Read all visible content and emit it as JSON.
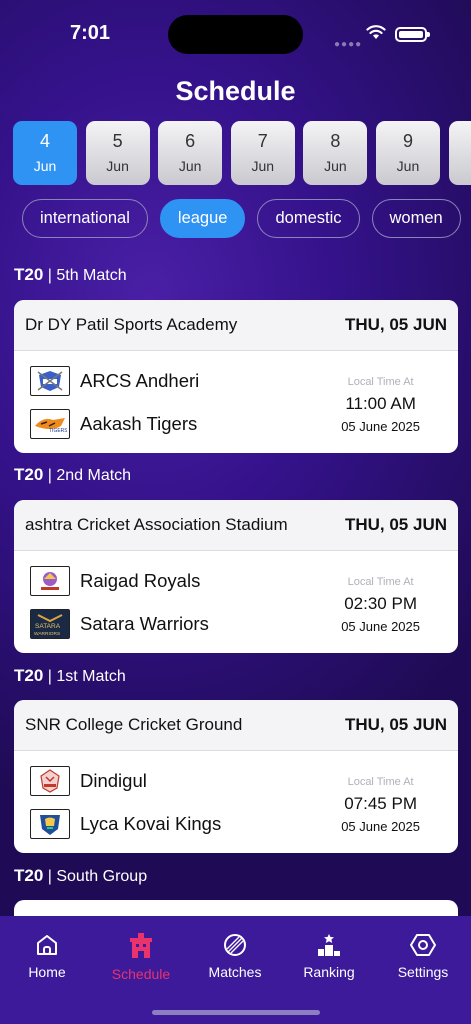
{
  "status": {
    "time": "7:01"
  },
  "page": {
    "title": "Schedule"
  },
  "dates": [
    {
      "day": "4",
      "month": "Jun",
      "active": true
    },
    {
      "day": "5",
      "month": "Jun"
    },
    {
      "day": "6",
      "month": "Jun"
    },
    {
      "day": "7",
      "month": "Jun"
    },
    {
      "day": "8",
      "month": "Jun"
    },
    {
      "day": "9",
      "month": "Jun"
    }
  ],
  "filters": [
    {
      "label": "international"
    },
    {
      "label": "league",
      "active": true
    },
    {
      "label": "domestic"
    },
    {
      "label": "women"
    }
  ],
  "matches": [
    {
      "format": "T20",
      "separator": "|",
      "stage": "5th Match",
      "venue": "Dr DY Patil Sports Academy",
      "date_label": "THU, 05 JUN",
      "team1": "ARCS Andheri",
      "team2": "Aakash Tigers",
      "local_time_label": "Local Time At",
      "time": "11:00 AM",
      "date": "05 June 2025"
    },
    {
      "format": "T20",
      "separator": "|",
      "stage": "2nd Match",
      "venue": "ashtra Cricket Association Stadium",
      "date_label": "THU, 05 JUN",
      "team1": "Raigad Royals",
      "team2": "Satara Warriors",
      "local_time_label": "Local Time At",
      "time": "02:30 PM",
      "date": "05 June 2025"
    },
    {
      "format": "T20",
      "separator": "|",
      "stage": "1st Match",
      "venue": "SNR College Cricket Ground",
      "date_label": "THU, 05 JUN",
      "team1": "Dindigul",
      "team2": "Lyca Kovai Kings",
      "local_time_label": "Local Time At",
      "time": "07:45 PM",
      "date": "05 June 2025"
    },
    {
      "format": "T20",
      "separator": "|",
      "stage": "South Group"
    }
  ],
  "tabs": [
    {
      "label": "Home",
      "icon": "home-icon"
    },
    {
      "label": "Schedule",
      "icon": "stadium-icon",
      "active": true
    },
    {
      "label": "Matches",
      "icon": "cricket-ball-icon"
    },
    {
      "label": "Ranking",
      "icon": "podium-icon"
    },
    {
      "label": "Settings",
      "icon": "settings-icon"
    }
  ],
  "colors": {
    "accent": "#2f93f4",
    "active_tab": "#e8336d",
    "tabbar": "#3d1a9a",
    "background": "#2a1072"
  }
}
